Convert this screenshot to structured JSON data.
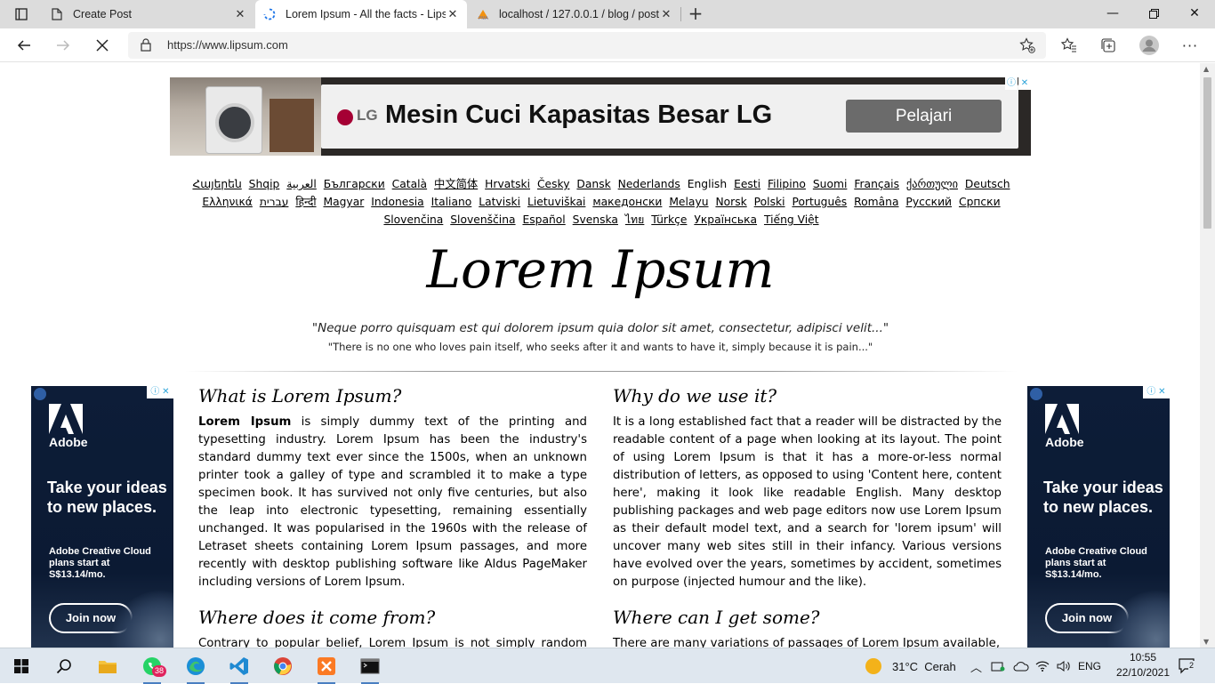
{
  "browser": {
    "tabs": [
      {
        "title": "Create Post",
        "active": false
      },
      {
        "title": "Lorem Ipsum - All the facts - Lips",
        "active": true
      },
      {
        "title": "localhost / 127.0.0.1 / blog / post",
        "active": false
      }
    ],
    "url": "https://www.lipsum.com"
  },
  "top_ad": {
    "brand": "LG",
    "headline": "Mesin Cuci Kapasitas Besar LG",
    "cta": "Pelajari"
  },
  "languages": [
    {
      "label": "Հայերեն",
      "current": false
    },
    {
      "label": "Shqip",
      "current": false
    },
    {
      "label": "العربية",
      "current": false
    },
    {
      "label": "Български",
      "current": false
    },
    {
      "label": "Català",
      "current": false
    },
    {
      "label": "中文简体",
      "current": false
    },
    {
      "label": "Hrvatski",
      "current": false
    },
    {
      "label": "Česky",
      "current": false
    },
    {
      "label": "Dansk",
      "current": false
    },
    {
      "label": "Nederlands",
      "current": false
    },
    {
      "label": "English",
      "current": true
    },
    {
      "label": "Eesti",
      "current": false
    },
    {
      "label": "Filipino",
      "current": false
    },
    {
      "label": "Suomi",
      "current": false
    },
    {
      "label": "Français",
      "current": false
    },
    {
      "label": "ქართული",
      "current": false
    },
    {
      "label": "Deutsch",
      "current": false
    },
    {
      "label": "Ελληνικά",
      "current": false
    },
    {
      "label": "עברית",
      "current": false
    },
    {
      "label": "हिन्दी",
      "current": false
    },
    {
      "label": "Magyar",
      "current": false
    },
    {
      "label": "Indonesia",
      "current": false
    },
    {
      "label": "Italiano",
      "current": false
    },
    {
      "label": "Latviski",
      "current": false
    },
    {
      "label": "Lietuviškai",
      "current": false
    },
    {
      "label": "македонски",
      "current": false
    },
    {
      "label": "Melayu",
      "current": false
    },
    {
      "label": "Norsk",
      "current": false
    },
    {
      "label": "Polski",
      "current": false
    },
    {
      "label": "Português",
      "current": false
    },
    {
      "label": "Româna",
      "current": false
    },
    {
      "label": "Pyccкий",
      "current": false
    },
    {
      "label": "Српски",
      "current": false
    },
    {
      "label": "Slovenčina",
      "current": false
    },
    {
      "label": "Slovenščina",
      "current": false
    },
    {
      "label": "Español",
      "current": false
    },
    {
      "label": "Svenska",
      "current": false
    },
    {
      "label": "ไทย",
      "current": false
    },
    {
      "label": "Türkçe",
      "current": false
    },
    {
      "label": "Українська",
      "current": false
    },
    {
      "label": "Tiếng Việt",
      "current": false
    }
  ],
  "hero": {
    "title": "Lorem Ipsum",
    "quote_latin": "\"Neque porro quisquam est qui dolorem ipsum quia dolor sit amet, consectetur, adipisci velit...\"",
    "quote_english": "\"There is no one who loves pain itself, who seeks after it and wants to have it, simply because it is pain...\""
  },
  "side_ad": {
    "brand": "Adobe",
    "headline": "Take your ideas to new places.",
    "subline": "Adobe Creative Cloud plans start at S$13.14/mo.",
    "cta": "Join now"
  },
  "sections": {
    "what": {
      "heading": "What is Lorem Ipsum?",
      "lead": "Lorem Ipsum",
      "body": " is simply dummy text of the printing and typesetting industry. Lorem Ipsum has been the industry's standard dummy text ever since the 1500s, when an unknown printer took a galley of type and scrambled it to make a type specimen book. It has survived not only five centuries, but also the leap into electronic typesetting, remaining essentially unchanged. It was popularised in the 1960s with the release of Letraset sheets containing Lorem Ipsum passages, and more recently with desktop publishing software like Aldus PageMaker including versions of Lorem Ipsum."
    },
    "why": {
      "heading": "Why do we use it?",
      "body": "It is a long established fact that a reader will be distracted by the readable content of a page when looking at its layout. The point of using Lorem Ipsum is that it has a more-or-less normal distribution of letters, as opposed to using 'Content here, content here', making it look like readable English. Many desktop publishing packages and web page editors now use Lorem Ipsum as their default model text, and a search for 'lorem ipsum' will uncover many web sites still in their infancy. Various versions have evolved over the years, sometimes by accident, sometimes on purpose (injected humour and the like)."
    },
    "where_from": {
      "heading": "Where does it come from?",
      "body": "Contrary to popular belief, Lorem Ipsum is not simply random text."
    },
    "where_get": {
      "heading": "Where can I get some?",
      "body": "There are many variations of passages of Lorem Ipsum available,"
    }
  },
  "taskbar": {
    "whatsapp_badge": "38",
    "weather": "31°C  Cerah",
    "language": "ENG",
    "time": "10:55",
    "date": "22/10/2021",
    "notifications": "2"
  }
}
